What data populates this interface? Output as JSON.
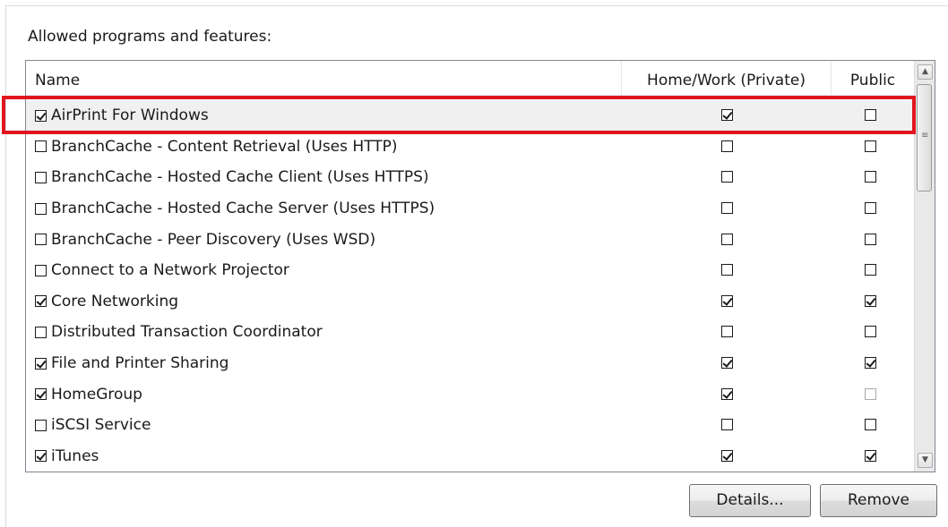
{
  "section_label": "Allowed programs and features:",
  "columns": {
    "name": "Name",
    "private": "Home/Work (Private)",
    "public": "Public"
  },
  "rows": [
    {
      "name": "AirPrint For Windows",
      "enabled": true,
      "private": true,
      "public": false,
      "selected": true
    },
    {
      "name": "BranchCache - Content Retrieval (Uses HTTP)",
      "enabled": false,
      "private": false,
      "public": false
    },
    {
      "name": "BranchCache - Hosted Cache Client (Uses HTTPS)",
      "enabled": false,
      "private": false,
      "public": false
    },
    {
      "name": "BranchCache - Hosted Cache Server (Uses HTTPS)",
      "enabled": false,
      "private": false,
      "public": false
    },
    {
      "name": "BranchCache - Peer Discovery (Uses WSD)",
      "enabled": false,
      "private": false,
      "public": false
    },
    {
      "name": "Connect to a Network Projector",
      "enabled": false,
      "private": false,
      "public": false
    },
    {
      "name": "Core Networking",
      "enabled": true,
      "private": true,
      "public": true
    },
    {
      "name": "Distributed Transaction Coordinator",
      "enabled": false,
      "private": false,
      "public": false
    },
    {
      "name": "File and Printer Sharing",
      "enabled": true,
      "private": true,
      "public": true
    },
    {
      "name": "HomeGroup",
      "enabled": true,
      "private": true,
      "public": false,
      "public_disabled": true
    },
    {
      "name": "iSCSI Service",
      "enabled": false,
      "private": false,
      "public": false
    },
    {
      "name": "iTunes",
      "enabled": true,
      "private": true,
      "public": true
    }
  ],
  "buttons": {
    "details": "Details...",
    "remove": "Remove"
  },
  "colors": {
    "highlight": "#e0151d"
  }
}
